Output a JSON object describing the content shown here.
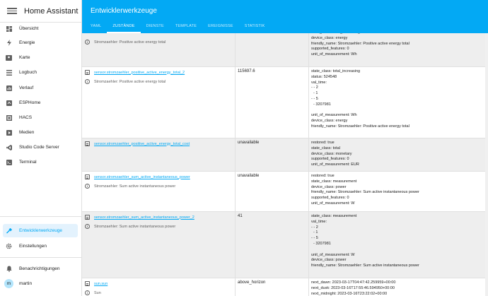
{
  "sidebar": {
    "title": "Home Assistant",
    "items": [
      {
        "label": "Übersicht",
        "icon": "dashboard-icon"
      },
      {
        "label": "Energie",
        "icon": "lightning-icon"
      },
      {
        "label": "Karte",
        "icon": "map-icon"
      },
      {
        "label": "Logbuch",
        "icon": "list-icon"
      },
      {
        "label": "Verlauf",
        "icon": "chart-icon"
      },
      {
        "label": "ESPHome",
        "icon": "esphome-icon"
      },
      {
        "label": "HACS",
        "icon": "hacs-icon"
      },
      {
        "label": "Medien",
        "icon": "media-icon"
      },
      {
        "label": "Studio Code Server",
        "icon": "vscode-icon"
      },
      {
        "label": "Terminal",
        "icon": "terminal-icon"
      }
    ],
    "developer_tools": "Entwicklerwerkzeuge",
    "settings": "Einstellungen",
    "notifications": "Benachrichtigungen",
    "user": "martin",
    "user_initial": "m"
  },
  "header": {
    "title": "Entwicklerwerkzeuge",
    "tabs": [
      "YAML",
      "ZUSTÄNDE",
      "DIENSTE",
      "TEMPLATE",
      "EREIGNISSE",
      "STATISTIK"
    ]
  },
  "rows": [
    {
      "entity": "",
      "name": "Stromzaehler: Positive active energy total",
      "state": "",
      "attrs": "state_class: total_increasing\ndevice_class: energy\nfriendly_name: Stromzaehler: Positive active energy total\nsupported_features: 0\nunit_of_measurement: Wh"
    },
    {
      "entity": "sensor.stromzaehler_positive_active_energy_total_2",
      "name": "Stromzaehler: Positive active energy total",
      "state": "115697.6",
      "attrs": "state_class: total_increasing\nstatus: 524548\nval_time:\n- - 2\n  - 1\n- - 5\n  - 3207981\n\nunit_of_measurement: Wh\ndevice_class: energy\nfriendly_name: Stromzaehler: Positive active energy total"
    },
    {
      "entity": "sensor.stromzaehler_positive_active_energy_total_cost",
      "name": "",
      "state": "unavailable",
      "attrs": "restored: true\nstate_class: total\ndevice_class: monetary\nsupported_features: 0\nunit_of_measurement: EUR"
    },
    {
      "entity": "sensor.stromzaehler_sum_active_instantaneous_power",
      "name": "Stromzaehler: Sum active instantaneous power",
      "state": "unavailable",
      "attrs": "restored: true\nstate_class: measurement\ndevice_class: power\nfriendly_name: Stromzaehler: Sum active instantaneous power\nsupported_features: 0\nunit_of_measurement: W"
    },
    {
      "entity": "sensor.stromzaehler_sum_active_instantaneous_power_2",
      "name": "Stromzaehler: Sum active instantaneous power",
      "state": "41",
      "attrs": "state_class: measurement\nval_time:\n- - 2\n  - 1\n- - 5\n  - 3207981\n\nunit_of_measurement: W\ndevice_class: power\nfriendly_name: Stromzaehler: Sum active instantaneous power"
    },
    {
      "entity": "sun.sun",
      "name": "Sun",
      "state": "above_horizon",
      "attrs": "next_dawn: 2023-03-17T04:47:42.259959+00:00\nnext_dusk: 2023-03-16T17:55:46.594950+00:00\nnext_midnight: 2023-03-16T23:22:02+00:00"
    }
  ]
}
